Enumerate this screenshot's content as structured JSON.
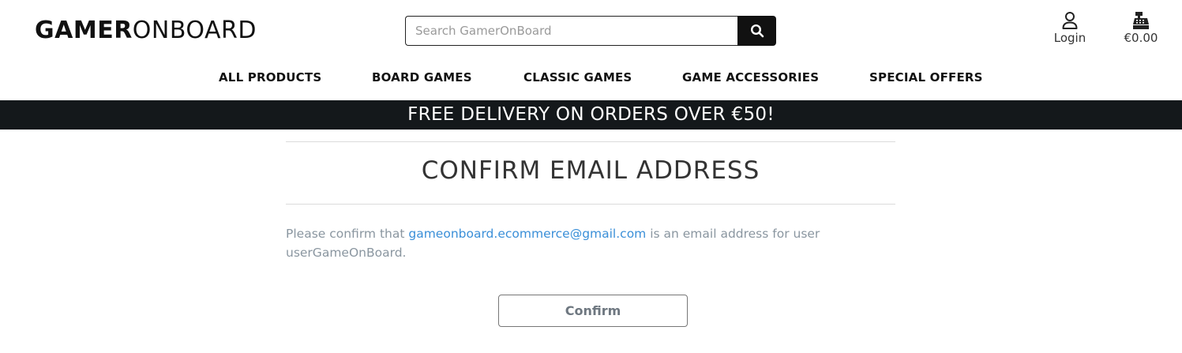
{
  "brand": {
    "logo_bold": "GAMER",
    "logo_light": "ONBOARD"
  },
  "search": {
    "placeholder": "Search GamerOnBoard",
    "icon": "search-icon"
  },
  "account": {
    "icon": "user-icon",
    "label": "Login"
  },
  "bag": {
    "icon": "cash-register-icon",
    "total": "€0.00"
  },
  "nav": {
    "items": [
      {
        "label": "ALL PRODUCTS"
      },
      {
        "label": "BOARD GAMES"
      },
      {
        "label": "CLASSIC GAMES"
      },
      {
        "label": "GAME ACCESSORIES"
      },
      {
        "label": "SPECIAL OFFERS"
      }
    ]
  },
  "banner": {
    "text": "FREE DELIVERY ON ORDERS OVER €50!"
  },
  "page": {
    "title": "CONFIRM EMAIL ADDRESS",
    "message_before": "Please confirm that ",
    "email": "gameonboard.ecommerce@gmail.com",
    "message_after": " is an email address for user userGameOnBoard.",
    "confirm_label": "Confirm"
  },
  "colors": {
    "banner_bg": "#14181b",
    "link": "#3a8fd8",
    "muted_text": "#8a96a0"
  }
}
